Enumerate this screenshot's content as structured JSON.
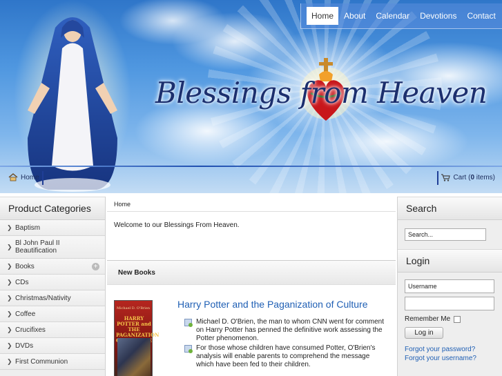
{
  "topnav": {
    "items": [
      {
        "label": "Home",
        "active": true
      },
      {
        "label": "About"
      },
      {
        "label": "Calendar"
      },
      {
        "label": "Devotions"
      },
      {
        "label": "Contact"
      }
    ]
  },
  "header": {
    "title": "Blessings from Heaven",
    "home_label": "Home",
    "cart_prefix": "Cart (",
    "cart_count": "0",
    "cart_suffix": " items)"
  },
  "categories": {
    "heading": "Product Categories",
    "items": [
      {
        "label": "Baptism"
      },
      {
        "label": "Bl John Paul II Beautification"
      },
      {
        "label": "Books",
        "expandable": true
      },
      {
        "label": "CDs"
      },
      {
        "label": "Christmas/Nativity"
      },
      {
        "label": "Coffee"
      },
      {
        "label": "Crucifixes"
      },
      {
        "label": "DVDs"
      },
      {
        "label": "First Communion"
      }
    ]
  },
  "main": {
    "breadcrumb": "Home",
    "welcome": "Welcome to our Blessings From Heaven.",
    "section_heading": "New Books",
    "book": {
      "title": "Harry Potter and the Paganization of Culture",
      "cover_author": "Michael D. O'Brien",
      "cover_title": "HARRY POTTER and THE PAGANIZATION OF CULTURE",
      "bullets": [
        "Michael D. O'Brien, the man to whom CNN went for comment on Harry Potter has penned the definitive work assessing the Potter phenomenon.",
        "For those whose children have consumed Potter, O'Brien's analysis will enable parents to comprehend the message which have been fed to their children."
      ]
    }
  },
  "sidebar_right": {
    "search_heading": "Search",
    "search_value": "Search...",
    "login_heading": "Login",
    "username_value": "Username",
    "password_value": "",
    "remember_label": "Remember Me",
    "login_button": "Log in",
    "forgot_password": "Forgot your password?",
    "forgot_username": "Forgot your username?"
  },
  "colors": {
    "link_blue": "#1f5fb4",
    "nav_bar": "#5a8cdc",
    "title_navy": "#1c2f6e"
  }
}
